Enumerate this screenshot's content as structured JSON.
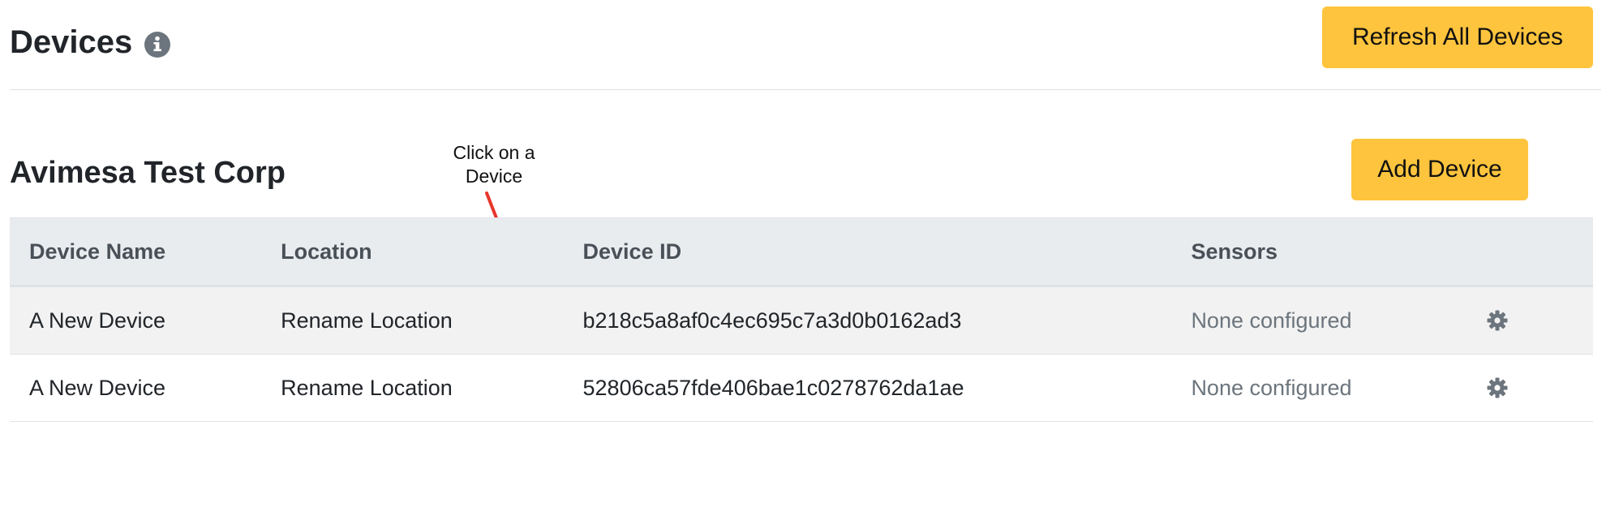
{
  "header": {
    "title": "Devices",
    "info_icon": "info-circle-icon",
    "refresh_label": "Refresh All Devices"
  },
  "section": {
    "org_name": "Avimesa Test Corp",
    "add_device_label": "Add Device"
  },
  "annotation": {
    "text_line1": "Click on a",
    "text_line2": "Device",
    "arrow_color": "#e8352b"
  },
  "table": {
    "columns": [
      "Device Name",
      "Location",
      "Device ID",
      "Sensors"
    ],
    "rows": [
      {
        "name": "A New Device",
        "location": "Rename Location",
        "device_id": "b218c5a8af0c4ec695c7a3d0b0162ad3",
        "sensors": "None configured",
        "action_icon": "gear-icon"
      },
      {
        "name": "A New Device",
        "location": "Rename Location",
        "device_id": "52806ca57fde406bae1c0278762da1ae",
        "sensors": "None configured",
        "action_icon": "gear-icon"
      }
    ]
  },
  "colors": {
    "accent_button": "#ffc43d",
    "header_row": "#e9ecef",
    "icon_gray": "#6c757d"
  }
}
